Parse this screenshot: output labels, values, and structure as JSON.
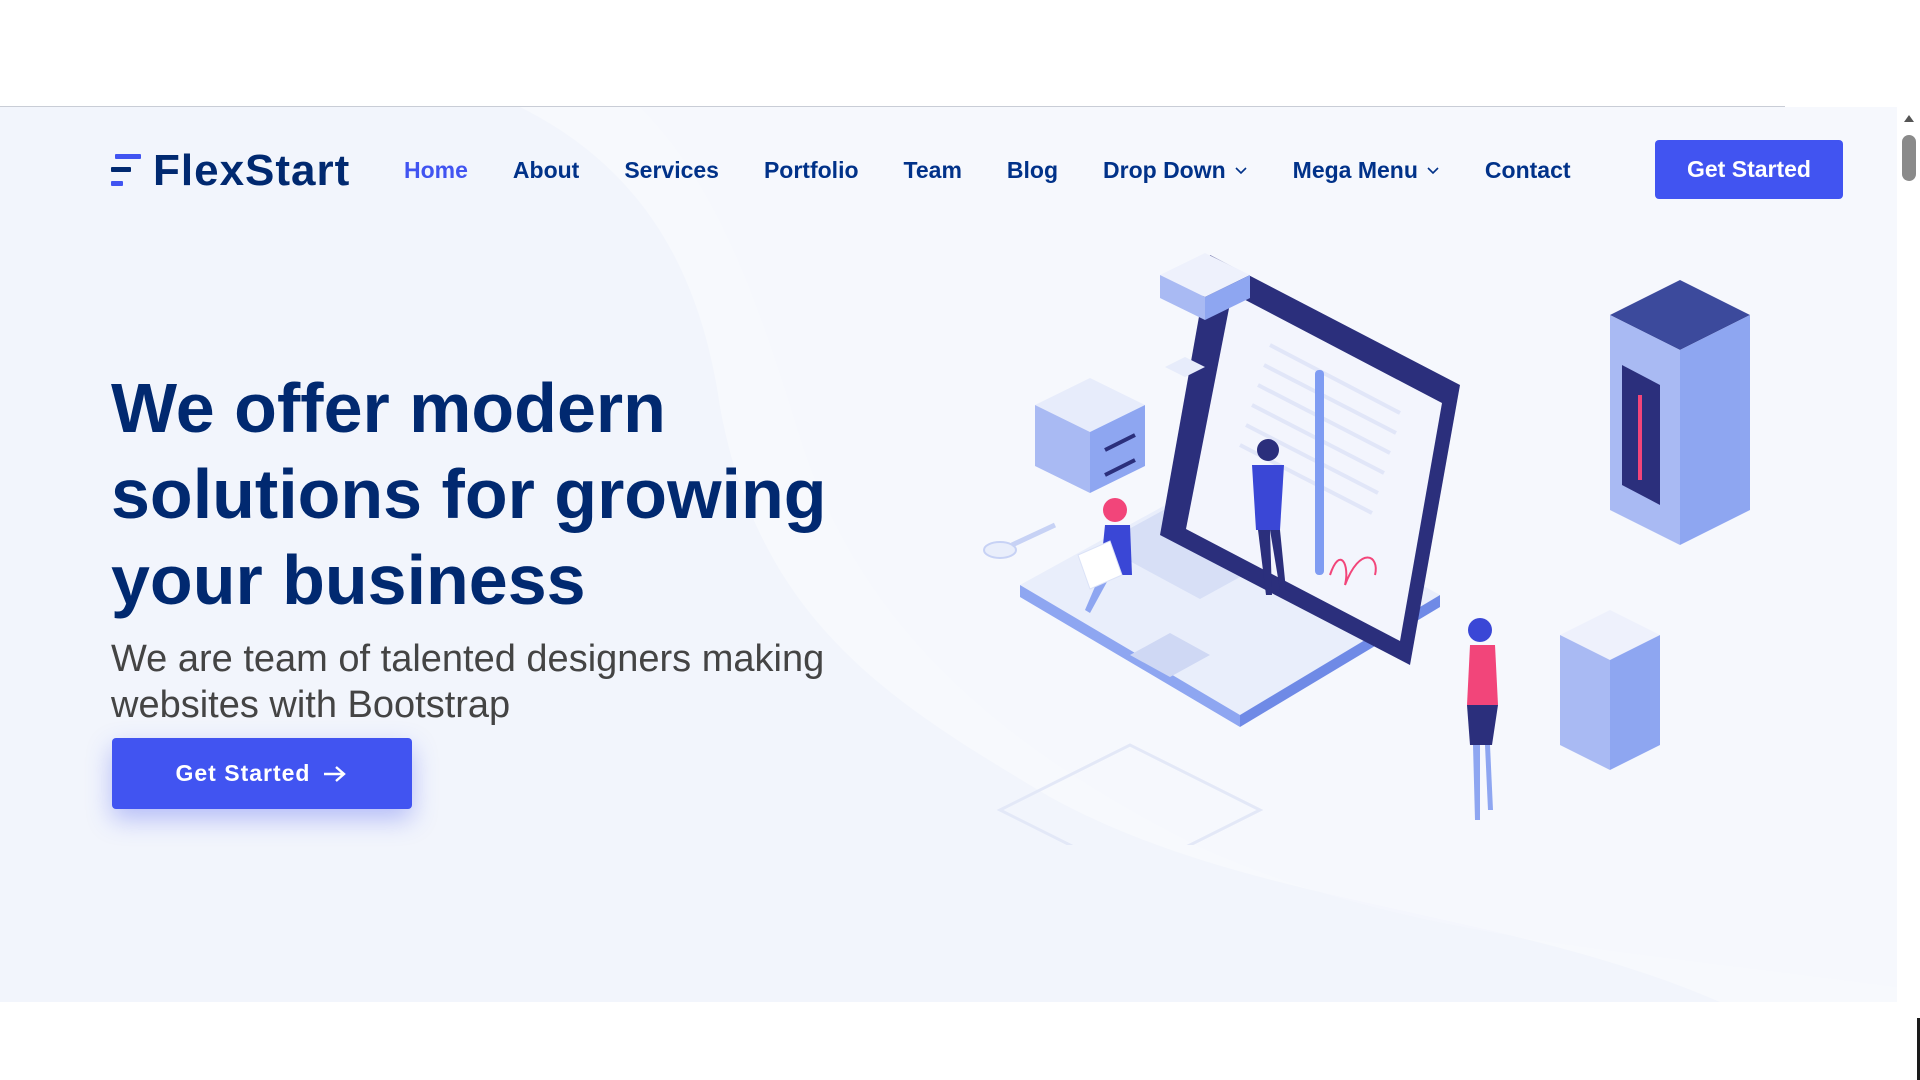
{
  "brand": {
    "name": "FlexStart",
    "logo_icon": "flexstart-logo-icon"
  },
  "nav": {
    "items": [
      {
        "label": "Home",
        "active": true
      },
      {
        "label": "About"
      },
      {
        "label": "Services"
      },
      {
        "label": "Portfolio"
      },
      {
        "label": "Team"
      },
      {
        "label": "Blog"
      },
      {
        "label": "Drop Down",
        "icon": "chevron-down-icon"
      },
      {
        "label": "Mega Menu",
        "icon": "chevron-down-icon"
      },
      {
        "label": "Contact"
      }
    ],
    "cta_label": "Get Started"
  },
  "hero": {
    "headline": "We offer modern solutions for growing your business",
    "subheading": "We are team of talented designers making websites with Bootstrap",
    "cta_label": "Get Started",
    "cta_icon": "arrow-right-icon",
    "illustration": "isometric-laptop-team-illustration"
  },
  "colors": {
    "accent": "#4154f1",
    "heading": "#012970",
    "nav_text": "#013289",
    "hero_bg": "#f2f5fc",
    "body_text": "#444444"
  }
}
